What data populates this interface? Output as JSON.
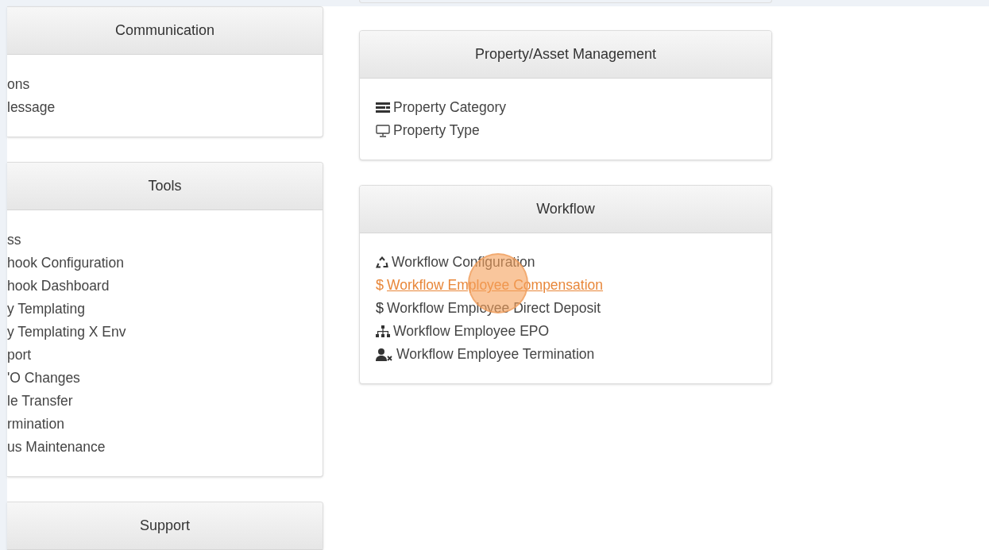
{
  "left_panels": [
    {
      "title": "Communication",
      "items": [
        {
          "label": "ons"
        },
        {
          "label": "lessage"
        }
      ]
    },
    {
      "title": "Tools",
      "items": [
        {
          "label": "ss"
        },
        {
          "label": "hook Configuration"
        },
        {
          "label": "hook Dashboard"
        },
        {
          "label": "y Templating"
        },
        {
          "label": "y Templating X Env"
        },
        {
          "label": "port"
        },
        {
          "label": "'O Changes"
        },
        {
          "label": "le Transfer"
        },
        {
          "label": "rmination"
        },
        {
          "label": "us Maintenance"
        }
      ]
    },
    {
      "title": "Support"
    }
  ],
  "right_panels": [
    {
      "title": "Property/Asset Management",
      "items": [
        {
          "kind": "list",
          "label": "Property Category",
          "active": false
        },
        {
          "kind": "monitor",
          "label": "Property Type",
          "active": false
        }
      ]
    },
    {
      "title": "Workflow",
      "items": [
        {
          "kind": "recycle",
          "label": "Workflow Configuration",
          "active": false
        },
        {
          "kind": "glyph",
          "glyph": "$",
          "label": "Workflow Employee Compensation",
          "active": true
        },
        {
          "kind": "glyph",
          "glyph": "$",
          "label": "Workflow Employee Direct Deposit",
          "active": false
        },
        {
          "kind": "sitemap",
          "label": "Workflow Employee EPO",
          "active": false
        },
        {
          "kind": "user-x",
          "label": "Workflow Employee Termination",
          "active": false
        }
      ]
    }
  ]
}
